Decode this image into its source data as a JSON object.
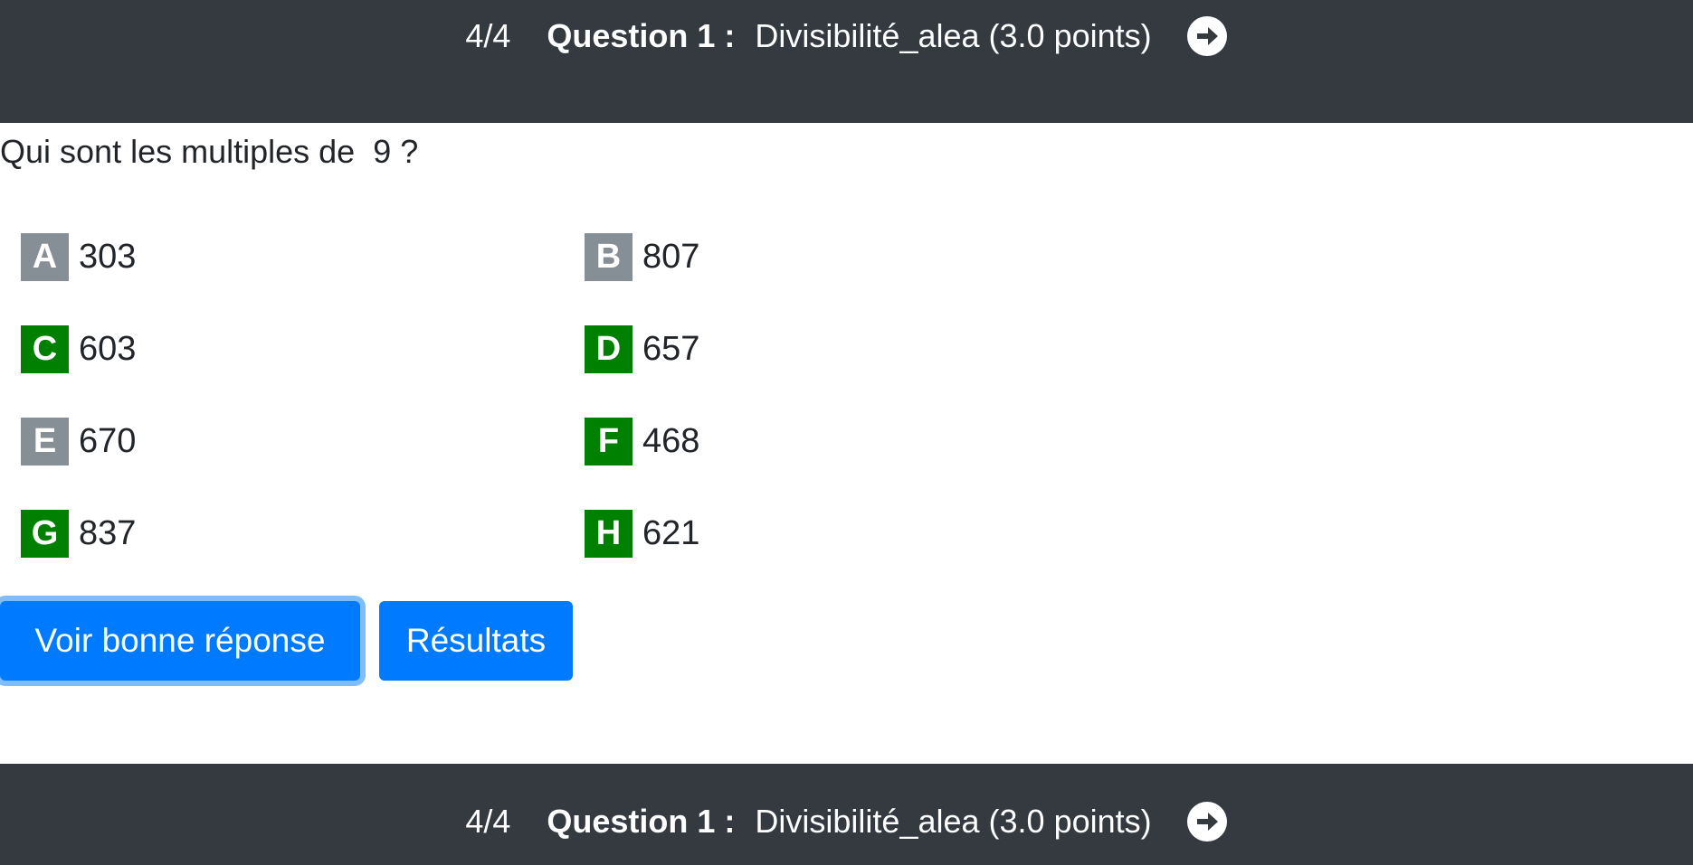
{
  "header": {
    "counter": "4/4",
    "question_label": "Question 1 :",
    "question_title": "Divisibilité_alea (3.0 points)",
    "next_icon": "arrow-circle-right-icon"
  },
  "question": {
    "text": "Qui sont les multiples de  9 ?"
  },
  "answers": [
    {
      "letter": "A",
      "value": "303",
      "status": "grey"
    },
    {
      "letter": "B",
      "value": "807",
      "status": "grey"
    },
    {
      "letter": "C",
      "value": "603",
      "status": "green"
    },
    {
      "letter": "D",
      "value": "657",
      "status": "green"
    },
    {
      "letter": "E",
      "value": "670",
      "status": "grey"
    },
    {
      "letter": "F",
      "value": "468",
      "status": "green"
    },
    {
      "letter": "G",
      "value": "837",
      "status": "green"
    },
    {
      "letter": "H",
      "value": "621",
      "status": "green"
    }
  ],
  "buttons": {
    "show_answer": "Voir bonne réponse",
    "results": "Résultats"
  },
  "footer": {
    "counter": "4/4",
    "question_label": "Question 1 :",
    "question_title": "Divisibilité_alea (3.0 points)",
    "next_icon": "arrow-circle-right-icon"
  },
  "colors": {
    "bar_bg": "#343a40",
    "grey_badge": "#868e96",
    "green_badge": "#008000",
    "primary": "#007bff"
  }
}
